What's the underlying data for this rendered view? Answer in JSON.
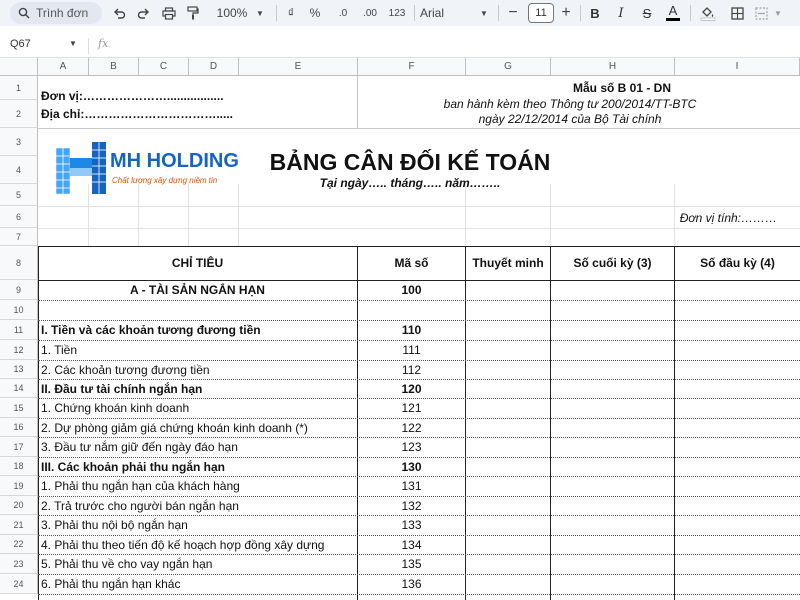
{
  "toolbar": {
    "search_placeholder": "Trình đơn",
    "zoom": "100%",
    "currency": "₫",
    "percent": "%",
    "dec_less": ".0",
    "dec_more": ".00",
    "number_format": "123",
    "font": "Arial",
    "font_size": "11",
    "bold": "B",
    "italic": "I",
    "strike": "S",
    "text_color": "A"
  },
  "formula_bar": {
    "cell_ref": "Q67",
    "fx": "fx"
  },
  "columns": [
    "A",
    "B",
    "C",
    "D",
    "E",
    "F",
    "G",
    "H",
    "I"
  ],
  "rows": [
    "1",
    "2",
    "3",
    "4",
    "5",
    "6",
    "7",
    "8",
    "9",
    "10",
    "11",
    "12",
    "13",
    "14",
    "15",
    "16",
    "17",
    "18",
    "19",
    "20",
    "21",
    "22",
    "23",
    "24"
  ],
  "header": {
    "unit_label": "Đơn vị:………………….................",
    "address_label": "Địa chỉ:…………………………….....",
    "form_code": "Mẫu số B 01 - DN",
    "issued_by": "ban hành kèm theo Thông tư 200/2014/TT-BTC",
    "issued_date": "ngày 22/12/2014 của Bộ Tài chính",
    "title": "BẢNG CÂN ĐỐI KẾ TOÁN",
    "date_line": "Tại ngày….. tháng….. năm……..",
    "currency_unit": "Đơn vị tính:………"
  },
  "logo": {
    "name": "MH HOLDING",
    "tagline": "Chất lượng xây dựng niềm tin",
    "colors": {
      "blue": "#1565c0",
      "light": "#42a5f5"
    }
  },
  "table": {
    "headers": {
      "item": "CHỈ TIÊU",
      "code": "Mã số",
      "note": "Thuyết minh",
      "end": "Số cuối kỳ (3)",
      "begin": "Số đầu kỳ (4)"
    },
    "section_a": {
      "label": "A - TÀI SẢN NGẮN HẠN",
      "code": "100"
    },
    "rows": [
      {
        "label": "I. Tiền và các khoản tương đương tiền",
        "code": "110",
        "bold": true
      },
      {
        "label": "1. Tiền",
        "code": "111",
        "bold": false
      },
      {
        "label": "2. Các khoản tương đương tiền",
        "code": "112",
        "bold": false
      },
      {
        "label": "II. Đầu tư tài chính ngắn hạn",
        "code": "120",
        "bold": true
      },
      {
        "label": "1. Chứng khoán kinh doanh",
        "code": "121",
        "bold": false
      },
      {
        "label": "2. Dự phòng giảm giá chứng khoán kinh doanh (*)",
        "code": "122",
        "bold": false
      },
      {
        "label": "3. Đầu tư nắm giữ đến ngày đáo hạn",
        "code": "123",
        "bold": false
      },
      {
        "label": "III. Các khoản phải thu ngắn hạn",
        "code": "130",
        "bold": true
      },
      {
        "label": "1. Phải thu ngắn hạn của khách hàng",
        "code": "131",
        "bold": false
      },
      {
        "label": "2. Trả trước cho người bán ngắn hạn",
        "code": "132",
        "bold": false
      },
      {
        "label": "3. Phải thu nội bộ ngắn hạn",
        "code": "133",
        "bold": false
      },
      {
        "label": "4. Phải thu theo tiến độ kế hoạch hợp đồng xây dựng",
        "code": "134",
        "bold": false
      },
      {
        "label": "5. Phải thu về cho vay ngắn hạn",
        "code": "135",
        "bold": false
      },
      {
        "label": "6. Phải thu ngắn hạn khác",
        "code": "136",
        "bold": false
      }
    ]
  }
}
